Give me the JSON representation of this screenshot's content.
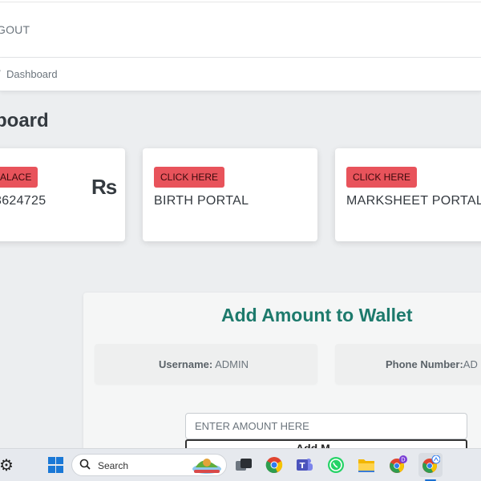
{
  "topbar": {
    "logout_label": "GOUT"
  },
  "breadcrumb": {
    "separator": "/",
    "label": "Dashboard"
  },
  "page": {
    "title": "board"
  },
  "cards": [
    {
      "badge": "ALACE",
      "value": "3624725",
      "currency": "Rs"
    },
    {
      "badge": "CLICK HERE",
      "value": "BIRTH PORTAL"
    },
    {
      "badge": "CLICK HERE",
      "value": "MARKSHEET PORTAL"
    }
  ],
  "wallet": {
    "title": "Add Amount to Wallet",
    "username_label": "Username:",
    "username_value": "ADMIN",
    "phone_label": "Phone Number:",
    "phone_value": "AD",
    "amount_placeholder": "ENTER AMOUNT HERE",
    "add_button_label": "Add M"
  },
  "taskbar": {
    "search_label": "Search",
    "icons": [
      "settings-icon",
      "windows-start-icon",
      "search-icon",
      "task-view-icon",
      "chrome-icon",
      "teams-icon",
      "whatsapp-icon",
      "file-explorer-icon",
      "chrome-profile-icon",
      "chrome-active-icon"
    ]
  },
  "colors": {
    "accent_red": "#e8535b",
    "wallet_title": "#1d7a6c",
    "taskbar": "#e6e9ee"
  }
}
